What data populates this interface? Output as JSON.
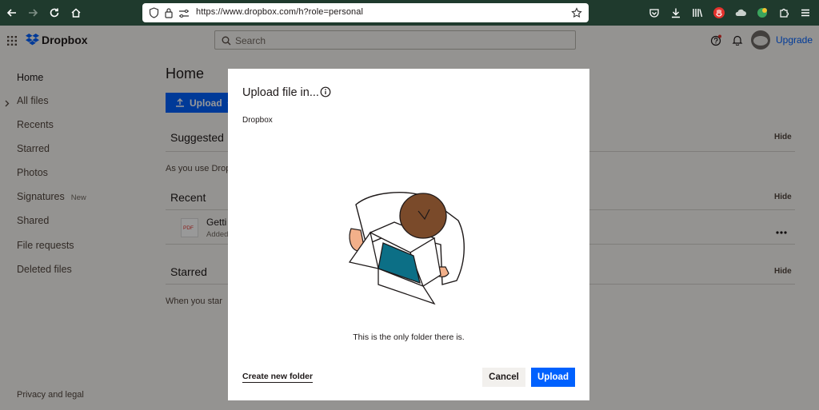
{
  "browser": {
    "url": "https://www.dropbox.com/h?role=personal"
  },
  "app": {
    "logo": "Dropbox",
    "search_placeholder": "Search",
    "upgrade": "Upgrade"
  },
  "sidebar": {
    "items": [
      {
        "label": "Home"
      },
      {
        "label": "All files"
      },
      {
        "label": "Recents"
      },
      {
        "label": "Starred"
      },
      {
        "label": "Photos"
      },
      {
        "label": "Signatures",
        "badge": "New"
      },
      {
        "label": "Shared"
      },
      {
        "label": "File requests"
      },
      {
        "label": "Deleted files"
      }
    ],
    "footer": "Privacy and legal"
  },
  "main": {
    "title": "Home",
    "upload_button": "Upload",
    "sections": [
      {
        "title": "Suggested",
        "hide": "Hide",
        "note": "As you use Drop"
      },
      {
        "title": "Recent",
        "hide": "Hide",
        "file_name": "Getti",
        "file_sub": "Added",
        "file_type": "PDF"
      },
      {
        "title": "Starred",
        "hide": "Hide",
        "note": "When you star"
      }
    ]
  },
  "modal": {
    "title": "Upload file in...",
    "breadcrumb": "Dropbox",
    "caption": "This is the only folder there is.",
    "create_folder": "Create new folder",
    "cancel": "Cancel",
    "upload": "Upload"
  },
  "colors": {
    "accent": "#0061fe",
    "browser_bg": "#1f3a2d",
    "page_bg": "#f7f5f2"
  }
}
